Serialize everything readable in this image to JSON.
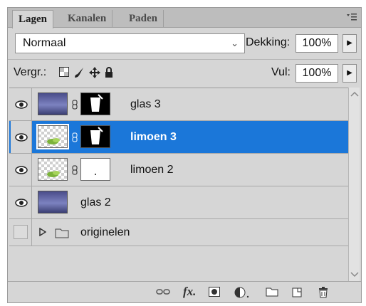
{
  "tabs": [
    "Lagen",
    "Kanalen",
    "Paden"
  ],
  "panel_menu_icon": "panel-menu-icon",
  "blend_mode": "Normaal",
  "opacity": {
    "label": "Dekking:",
    "value": "100%"
  },
  "lock": {
    "label": "Vergr.:",
    "icons": [
      "lock-transparent-icon",
      "lock-paint-icon",
      "lock-position-icon",
      "lock-all-icon"
    ]
  },
  "fill": {
    "label": "Vul:",
    "value": "100%"
  },
  "layers": [
    {
      "name": "glas 3",
      "visible": true,
      "selected": false
    },
    {
      "name": "limoen 3",
      "visible": true,
      "selected": true
    },
    {
      "name": "limoen 2",
      "visible": true,
      "selected": false
    },
    {
      "name": "glas 2",
      "visible": true,
      "selected": false
    },
    {
      "name": "originelen",
      "visible": false,
      "selected": false,
      "type": "group"
    }
  ],
  "footer_icons": [
    "link-layers-icon",
    "fx-icon",
    "add-mask-icon",
    "adjustment-layer-icon",
    "new-group-icon",
    "new-layer-icon",
    "trash-icon"
  ],
  "footer_fx": "fx",
  "selection_color": "#1b77d9"
}
